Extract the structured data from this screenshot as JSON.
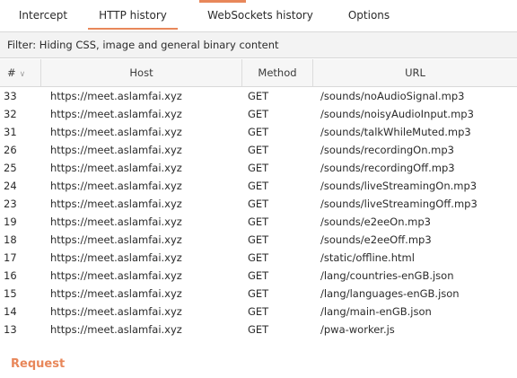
{
  "tabs": [
    {
      "label": "Intercept",
      "active": false
    },
    {
      "label": "HTTP history",
      "active": true
    },
    {
      "label": "WebSockets history",
      "active": false
    },
    {
      "label": "Options",
      "active": false
    }
  ],
  "accent_color": "#e8875a",
  "filter": {
    "text": "Filter: Hiding CSS, image and general binary content"
  },
  "table": {
    "columns": {
      "num": "#",
      "host": "Host",
      "method": "Method",
      "url": "URL"
    },
    "rows": [
      {
        "num": "33",
        "host": "https://meet.aslamfai.xyz",
        "method": "GET",
        "url": "/sounds/noAudioSignal.mp3"
      },
      {
        "num": "32",
        "host": "https://meet.aslamfai.xyz",
        "method": "GET",
        "url": "/sounds/noisyAudioInput.mp3"
      },
      {
        "num": "31",
        "host": "https://meet.aslamfai.xyz",
        "method": "GET",
        "url": "/sounds/talkWhileMuted.mp3"
      },
      {
        "num": "26",
        "host": "https://meet.aslamfai.xyz",
        "method": "GET",
        "url": "/sounds/recordingOn.mp3"
      },
      {
        "num": "25",
        "host": "https://meet.aslamfai.xyz",
        "method": "GET",
        "url": "/sounds/recordingOff.mp3"
      },
      {
        "num": "24",
        "host": "https://meet.aslamfai.xyz",
        "method": "GET",
        "url": "/sounds/liveStreamingOn.mp3"
      },
      {
        "num": "23",
        "host": "https://meet.aslamfai.xyz",
        "method": "GET",
        "url": "/sounds/liveStreamingOff.mp3"
      },
      {
        "num": "19",
        "host": "https://meet.aslamfai.xyz",
        "method": "GET",
        "url": "/sounds/e2eeOn.mp3"
      },
      {
        "num": "18",
        "host": "https://meet.aslamfai.xyz",
        "method": "GET",
        "url": "/sounds/e2eeOff.mp3"
      },
      {
        "num": "17",
        "host": "https://meet.aslamfai.xyz",
        "method": "GET",
        "url": "/static/offline.html"
      },
      {
        "num": "16",
        "host": "https://meet.aslamfai.xyz",
        "method": "GET",
        "url": "/lang/countries-enGB.json"
      },
      {
        "num": "15",
        "host": "https://meet.aslamfai.xyz",
        "method": "GET",
        "url": "/lang/languages-enGB.json"
      },
      {
        "num": "14",
        "host": "https://meet.aslamfai.xyz",
        "method": "GET",
        "url": "/lang/main-enGB.json"
      },
      {
        "num": "13",
        "host": "https://meet.aslamfai.xyz",
        "method": "GET",
        "url": "/pwa-worker.js"
      }
    ]
  },
  "request": {
    "title": "Request"
  }
}
